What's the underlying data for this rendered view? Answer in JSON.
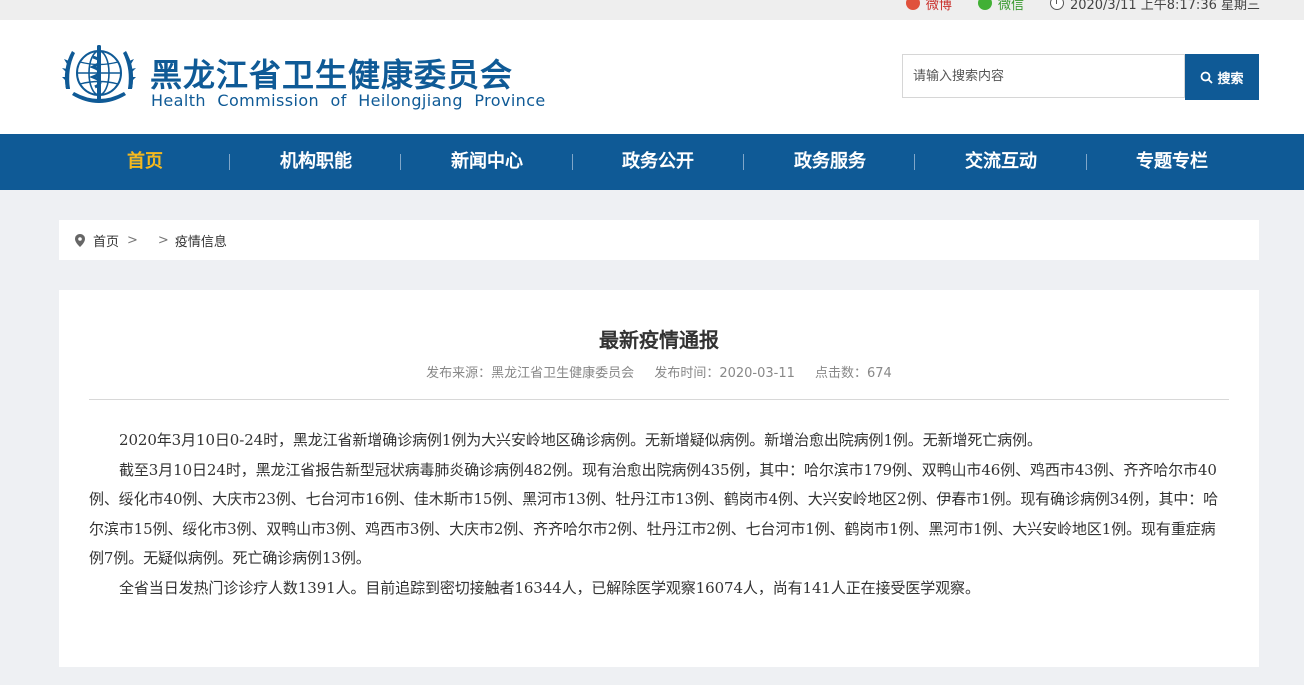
{
  "topbar": {
    "weibo_label": "微博",
    "weixin_label": "微信",
    "datetime": "2020/3/11 上午8:17:36 星期三"
  },
  "header": {
    "title_cn": "黑龙江省卫生健康委员会",
    "title_en": "Health Commission of Heilongjiang Province",
    "search_placeholder": "请输入搜索内容",
    "search_button": "搜索"
  },
  "nav": {
    "items": [
      "首页",
      "机构职能",
      "新闻中心",
      "政务公开",
      "政务服务",
      "交流互动",
      "专题专栏"
    ],
    "active_index": 0
  },
  "breadcrumb": {
    "home": "首页",
    "sep": ">",
    "current": "疫情信息"
  },
  "article": {
    "title": "最新疫情通报",
    "source": "发布来源：黑龙江省卫生健康委员会",
    "date": "发布时间：2020-03-11",
    "hits": "点击数：674",
    "paragraphs": [
      "2020年3月10日0-24时，黑龙江省新增确诊病例1例为大兴安岭地区确诊病例。无新增疑似病例。新增治愈出院病例1例。无新增死亡病例。",
      "截至3月10日24时，黑龙江省报告新型冠状病毒肺炎确诊病例482例。现有治愈出院病例435例，其中：哈尔滨市179例、双鸭山市46例、鸡西市43例、齐齐哈尔市40例、绥化市40例、大庆市23例、七台河市16例、佳木斯市15例、黑河市13例、牡丹江市13例、鹤岗市4例、大兴安岭地区2例、伊春市1例。现有确诊病例34例，其中：哈尔滨市15例、绥化市3例、双鸭山市3例、鸡西市3例、大庆市2例、齐齐哈尔市2例、牡丹江市2例、七台河市1例、鹤岗市1例、黑河市1例、大兴安岭地区1例。现有重症病例7例。无疑似病例。死亡确诊病例13例。",
      "全省当日发热门诊诊疗人数1391人。目前追踪到密切接触者16344人，已解除医学观察16074人，尚有141人正在接受医学观察。"
    ]
  },
  "colors": {
    "brand_blue": "#0f5a96",
    "nav_active": "#f5b91e",
    "page_bg": "#eef0f3"
  }
}
